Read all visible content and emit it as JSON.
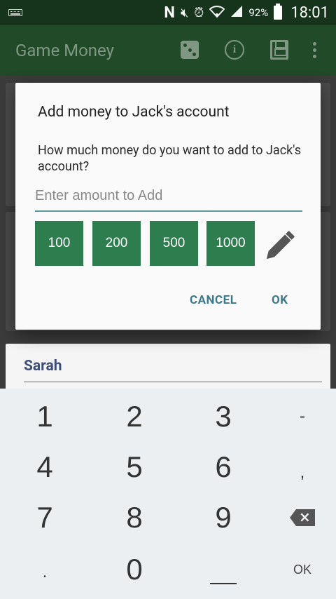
{
  "status_bar": {
    "battery_pct": "92%",
    "time": "18:01",
    "nfc": "N",
    "icons": [
      "keyboard-icon",
      "nfc-icon",
      "mute-icon",
      "alarm-icon",
      "wifi-icon",
      "signal-icon",
      "battery-icon"
    ]
  },
  "app_bar": {
    "title": "Game Money",
    "actions": [
      "dice-icon",
      "info-icon",
      "save-icon",
      "overflow-menu-icon"
    ],
    "info_glyph": "i"
  },
  "background": {
    "player_name": "Sarah"
  },
  "dialog": {
    "title": "Add money to Jack's account",
    "message": "How much money do you want to add to Jack's account?",
    "amount_placeholder": "Enter amount to Add",
    "amount_value": "",
    "presets": [
      "100",
      "200",
      "500",
      "1000"
    ],
    "cancel_label": "CANCEL",
    "ok_label": "OK"
  },
  "keyboard": {
    "keys": [
      "1",
      "2",
      "3",
      "-",
      "4",
      "5",
      "6",
      ",",
      "7",
      "8",
      "9",
      "backspace",
      ".",
      "0",
      "space",
      "OK"
    ],
    "labels": {
      "k1": "1",
      "k2": "2",
      "k3": "3",
      "minus": "-",
      "k4": "4",
      "k5": "5",
      "k6": "6",
      "comma": ",",
      "k7": "7",
      "k8": "8",
      "k9": "9",
      "period": ".",
      "k0": "0",
      "ok": "OK"
    }
  },
  "colors": {
    "status_bar": "#16341b",
    "app_bar": "#204a28",
    "preset_button": "#2e7d4e",
    "dialog_action": "#3b7a8a",
    "input_underline": "#5a9a98",
    "keyboard_bg": "#eceff1"
  }
}
